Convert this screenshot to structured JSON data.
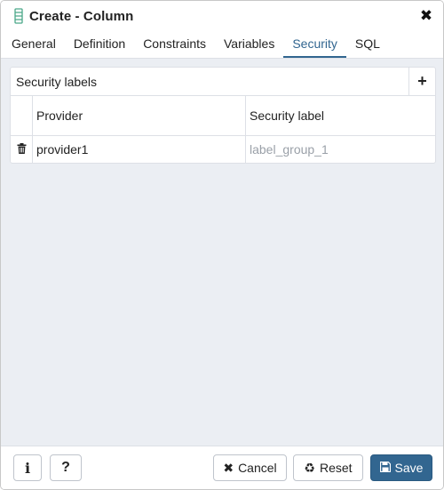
{
  "dialog": {
    "title": "Create - Column",
    "title_icon": "column-icon",
    "close_icon": "close-icon"
  },
  "tabs": [
    {
      "label": "General",
      "active": false
    },
    {
      "label": "Definition",
      "active": false
    },
    {
      "label": "Constraints",
      "active": false
    },
    {
      "label": "Variables",
      "active": false
    },
    {
      "label": "Security",
      "active": true
    },
    {
      "label": "SQL",
      "active": false
    }
  ],
  "security": {
    "panel_title": "Security labels",
    "add_icon": "plus-icon",
    "columns": {
      "provider": "Provider",
      "security_label": "Security label"
    },
    "rows": [
      {
        "provider": "provider1",
        "security_label": "label_group_1",
        "delete_icon": "trash-icon"
      }
    ]
  },
  "footer": {
    "info_icon": "info-icon",
    "help_label": "?",
    "cancel_label": "Cancel",
    "reset_label": "Reset",
    "save_label": "Save"
  },
  "colors": {
    "accent": "#326690",
    "background": "#ebeef3"
  }
}
